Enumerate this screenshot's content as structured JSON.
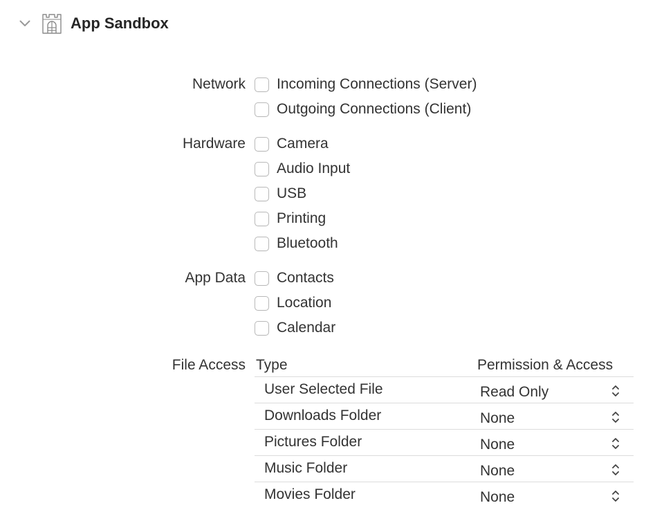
{
  "section": {
    "title": "App Sandbox",
    "expanded": true,
    "icon": "castle-icon",
    "disclosure_icon": "chevron-down-icon"
  },
  "network": {
    "label": "Network",
    "options": [
      {
        "label": "Incoming Connections (Server)",
        "checked": false
      },
      {
        "label": "Outgoing Connections (Client)",
        "checked": false
      }
    ]
  },
  "hardware": {
    "label": "Hardware",
    "options": [
      {
        "label": "Camera",
        "checked": false
      },
      {
        "label": "Audio Input",
        "checked": false
      },
      {
        "label": "USB",
        "checked": false
      },
      {
        "label": "Printing",
        "checked": false
      },
      {
        "label": "Bluetooth",
        "checked": false
      }
    ]
  },
  "app_data": {
    "label": "App Data",
    "options": [
      {
        "label": "Contacts",
        "checked": false
      },
      {
        "label": "Location",
        "checked": false
      },
      {
        "label": "Calendar",
        "checked": false
      }
    ]
  },
  "file_access": {
    "label": "File Access",
    "columns": {
      "type": "Type",
      "permission": "Permission & Access"
    },
    "rows": [
      {
        "type": "User Selected File",
        "permission": "Read Only"
      },
      {
        "type": "Downloads Folder",
        "permission": "None"
      },
      {
        "type": "Pictures Folder",
        "permission": "None"
      },
      {
        "type": "Music Folder",
        "permission": "None"
      },
      {
        "type": "Movies Folder",
        "permission": "None"
      }
    ]
  },
  "colors": {
    "text": "#333333",
    "title": "#262626",
    "checkbox_border": "#b9b9b9",
    "divider": "#dcdcdc",
    "icon": "#8a8a8a"
  }
}
